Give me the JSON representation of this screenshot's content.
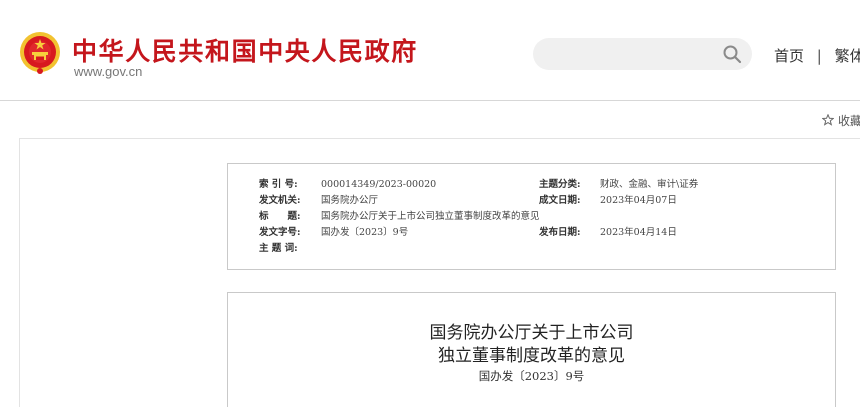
{
  "header": {
    "site_title": "中华人民共和国中央人民政府",
    "site_url": "www.gov.cn",
    "search": {
      "value": "",
      "placeholder": ""
    },
    "nav": {
      "home": "首页",
      "separator": "|",
      "traditional": "繁体"
    }
  },
  "favorite": {
    "label": "收藏"
  },
  "info": {
    "index_no": {
      "label": "索 引 号:",
      "value": "000014349/2023-00020"
    },
    "category": {
      "label": "主题分类:",
      "value": "财政、金融、审计\\证券"
    },
    "issuer": {
      "label": "发文机关:",
      "value": "国务院办公厅"
    },
    "written_date": {
      "label": "成文日期:",
      "value": "2023年04月07日"
    },
    "title": {
      "label": "标　　题:",
      "value": "国务院办公厅关于上市公司独立董事制度改革的意见"
    },
    "doc_number": {
      "label": "发文字号:",
      "value": "国办发〔2023〕9号"
    },
    "publish_date": {
      "label": "发布日期:",
      "value": "2023年04月14日"
    },
    "keywords": {
      "label": "主 题 词:",
      "value": ""
    }
  },
  "document": {
    "title_line1": "国务院办公厅关于上市公司",
    "title_line2": "独立董事制度改革的意见",
    "doc_number": "国办发〔2023〕9号"
  },
  "colors": {
    "brand_red": "#c4161c",
    "emblem_gold": "#f2c230"
  },
  "icons": {
    "emblem": "national-emblem-icon",
    "search": "search-icon",
    "favorite": "star-icon"
  }
}
